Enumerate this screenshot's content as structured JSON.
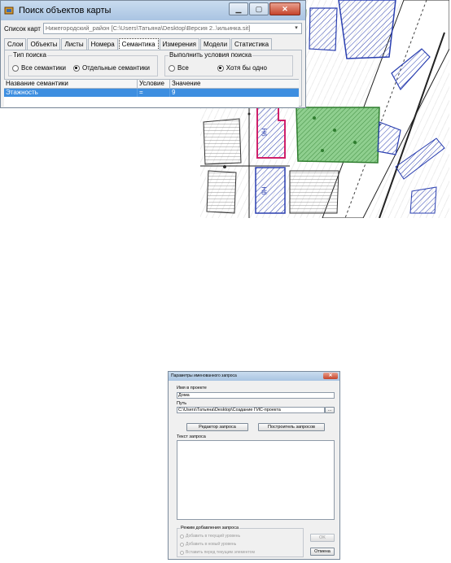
{
  "search_window": {
    "title": "Поиск объектов карты",
    "map_list_label": "Список карт",
    "map_list_value": "Нижегородский_район [C:\\Users\\Татьяна\\Desktop\\Версия 2..\\ильинка.sit]",
    "tabs": [
      "Слои",
      "Объекты",
      "Листы",
      "Номера",
      "Семантика",
      "Измерения",
      "Модели",
      "Статистика"
    ],
    "active_tab": "Семантика",
    "search_type": {
      "legend": "Тип поиска",
      "options": [
        "Все семантики",
        "Отдельные семантики"
      ],
      "selected": "Отдельные семантики"
    },
    "search_condition": {
      "legend": "Выполнить условия поиска",
      "options": [
        "Все",
        "Хотя бы одно"
      ],
      "selected": "Хотя бы одно"
    },
    "table": {
      "columns": [
        "Название семантики",
        "Условие",
        "Значение"
      ],
      "rows": [
        [
          "Этажность",
          "=",
          "9"
        ]
      ]
    }
  },
  "map": {
    "building_labels": [
      "9Н",
      "9Н"
    ]
  },
  "query_window": {
    "title": "Параметры именованного запроса",
    "name_label": "Имя в проекте",
    "name_value": "Дома",
    "path_label": "Путь",
    "path_value": "C:\\Users\\Татьяна\\Desktop\\Создание ГИС-проекта",
    "browse_label": "...",
    "editor_button": "Редактор запроса",
    "builder_button": "Построитель запросов",
    "text_label": "Текст запроса",
    "mode_legend": "Режим добавления запроса",
    "mode_options": [
      "Добавить в текущий уровень",
      "Добавить в новый уровень",
      "Вставить перед текущим элементом"
    ],
    "ok_button": "OK",
    "cancel_button": "Отмена"
  },
  "colors": {
    "selection": "#3d8ee0",
    "map_green": "#8fcf8f",
    "map_blue": "#2a3fb0",
    "map_magenta": "#d0206a"
  }
}
